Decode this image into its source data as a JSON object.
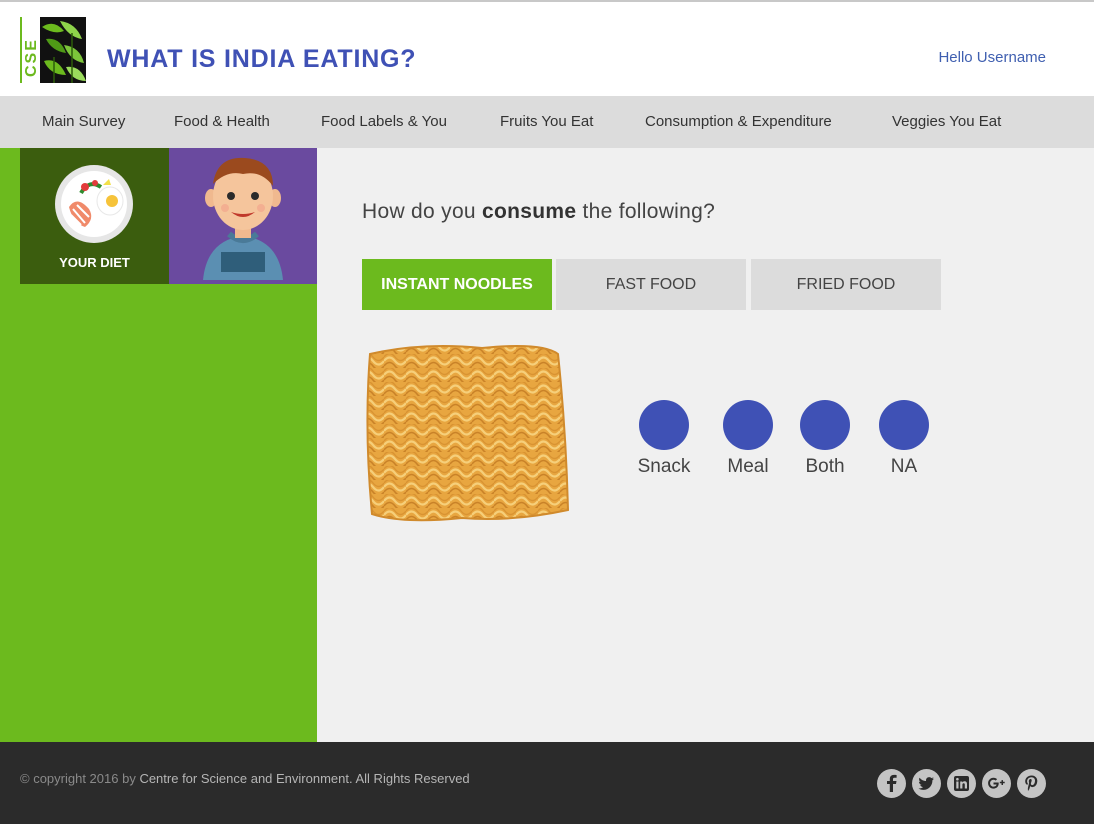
{
  "header": {
    "logo_text": "CSE",
    "title": "WHAT IS INDIA EATING?",
    "greeting": "Hello Username"
  },
  "nav": {
    "items": [
      {
        "label": "Main Survey"
      },
      {
        "label": "Food & Health"
      },
      {
        "label": "Food Labels & You"
      },
      {
        "label": "Fruits You Eat"
      },
      {
        "label": "Consumption & Expenditure"
      },
      {
        "label": "Veggies You Eat"
      }
    ]
  },
  "sidebar": {
    "diet_label": "YOUR DIET"
  },
  "main": {
    "question_pre": "How do you ",
    "question_bold": "consume",
    "question_post": " the following?",
    "tabs": [
      {
        "label": "INSTANT NOODLES",
        "active": true
      },
      {
        "label": "FAST FOOD",
        "active": false
      },
      {
        "label": "FRIED FOOD",
        "active": false
      }
    ],
    "options": [
      {
        "label": "Snack"
      },
      {
        "label": "Meal"
      },
      {
        "label": "Both"
      },
      {
        "label": "NA"
      }
    ]
  },
  "footer": {
    "copyright_prefix": "© copyright 2016 by ",
    "copyright_org": "Centre for Science and Environment. All Rights Reserved",
    "social_icons": [
      "facebook-icon",
      "twitter-icon",
      "linkedin-icon",
      "google-plus-icon",
      "pinterest-icon"
    ]
  },
  "colors": {
    "brand_blue": "#3f51b5",
    "brand_green": "#6cba1e",
    "dark_green": "#3b5d0e",
    "purple": "#6a4a9f",
    "footer_bg": "#2b2b2b"
  }
}
